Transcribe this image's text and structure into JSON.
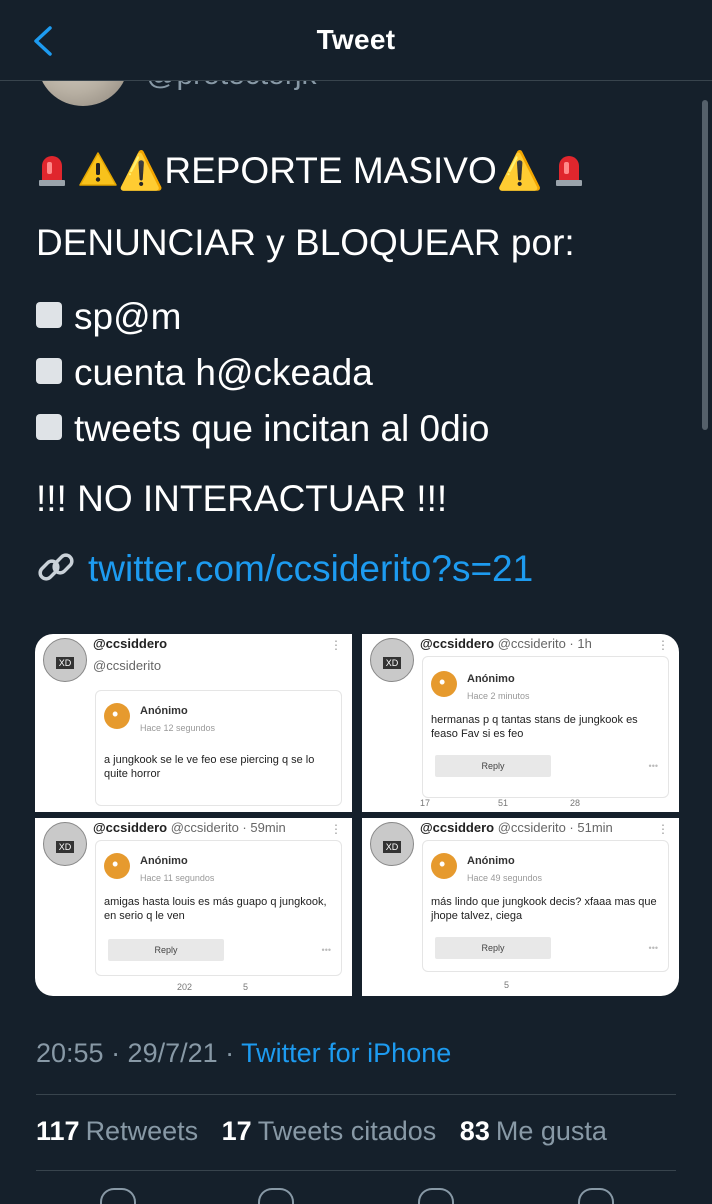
{
  "header": {
    "title": "Tweet"
  },
  "author": {
    "handle": "@protectorjk"
  },
  "tweet": {
    "heading": "⚠️REPORTE MASIVO⚠️",
    "line2": "DENUNCIAR y BLOQUEAR por:",
    "reasons": [
      "sp@m",
      "cuenta h@ckeada",
      "tweets que incitan al 0dio"
    ],
    "warning": "!!! NO INTERACTUAR !!!",
    "link": "twitter.com/ccsiderito?s=21"
  },
  "media": [
    {
      "name": "@ccsiddero",
      "handle": "@ccsiderito",
      "time": "",
      "author": "Anónimo",
      "ago": "Hace 12 segundos",
      "text": "a jungkook se le ve feo ese piercing q se lo quite horror",
      "reply": "",
      "stats": {}
    },
    {
      "name": "@ccsiddero",
      "handle": "@ccsiderito · 1h",
      "time": "",
      "author": "Anónimo",
      "ago": "Hace 2 minutos",
      "text": "hermanas p q tantas stans de jungkook es feaso Fav si es feo",
      "reply": "Reply",
      "stats": {
        "replies": "17",
        "retweets": "51",
        "likes": "28"
      }
    },
    {
      "name": "@ccsiddero",
      "handle": "@ccsiderito · 59min",
      "time": "",
      "author": "Anónimo",
      "ago": "Hace 11 segundos",
      "text": "amigas hasta louis es más guapo q jungkook, en serio q le ven",
      "reply": "Reply",
      "stats": {
        "retweets": "202",
        "likes": "5"
      }
    },
    {
      "name": "@ccsiddero",
      "handle": "@ccsiderito · 51min",
      "time": "",
      "author": "Anónimo",
      "ago": "Hace 49 segundos",
      "text": "más lindo que jungkook decis? xfaaa mas que jhope talvez, ciega",
      "reply": "Reply",
      "stats": {
        "retweets": "5"
      }
    }
  ],
  "meta": {
    "time": "20:55 · 29/7/21 · ",
    "source": "Twitter for iPhone"
  },
  "counts": {
    "retweets": "117",
    "retweets_label": "Retweets",
    "quotes": "17",
    "quotes_label": "Tweets citados",
    "likes": "83",
    "likes_label": "Me gusta"
  },
  "colors": {
    "background": "#15202b",
    "link": "#1d9bf0",
    "muted": "#8899a6"
  }
}
